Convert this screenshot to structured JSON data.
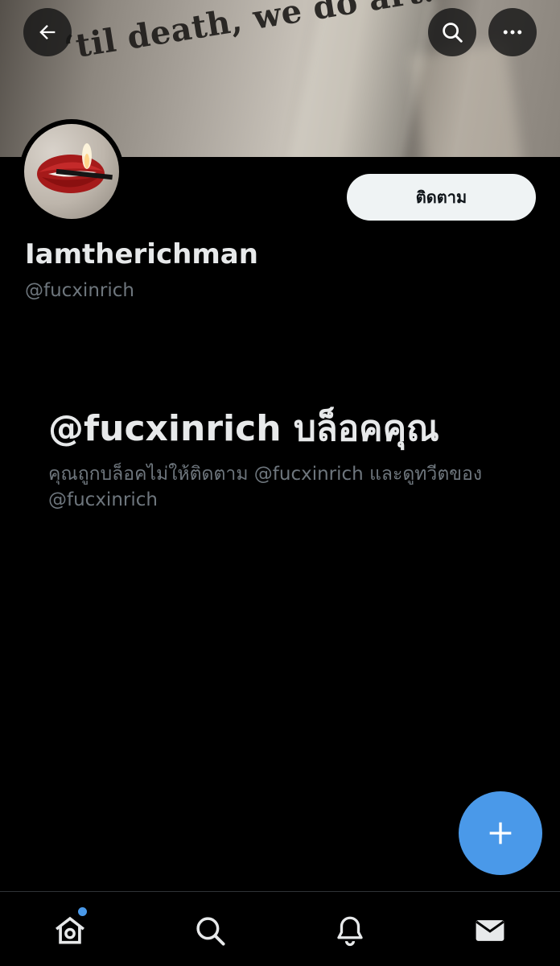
{
  "banner": {
    "text": "‘til death, we do art."
  },
  "header": {
    "back_icon": "back-arrow-icon",
    "search_icon": "search-icon",
    "more_icon": "more-horizontal-icon"
  },
  "profile": {
    "display_name": "Iamtherichman",
    "handle": "@fucxinrich",
    "follow_label": "ติดตาม"
  },
  "blocked": {
    "title": "@fucxinrich บล็อคคุณ",
    "description": "คุณถูกบล็อคไม่ให้ติดตาม @fucxinrich และดูทวีตของ @fucxinrich"
  },
  "fab": {
    "icon": "plus-icon"
  },
  "bottom_nav": {
    "items": [
      {
        "name": "home",
        "icon": "home-icon"
      },
      {
        "name": "search",
        "icon": "search-icon"
      },
      {
        "name": "notifications",
        "icon": "bell-icon"
      },
      {
        "name": "messages",
        "icon": "mail-icon"
      }
    ]
  },
  "colors": {
    "background": "#000000",
    "accent": "#4a99e9",
    "secondary_text": "#6e767d",
    "follow_button_bg": "#eff3f4"
  }
}
